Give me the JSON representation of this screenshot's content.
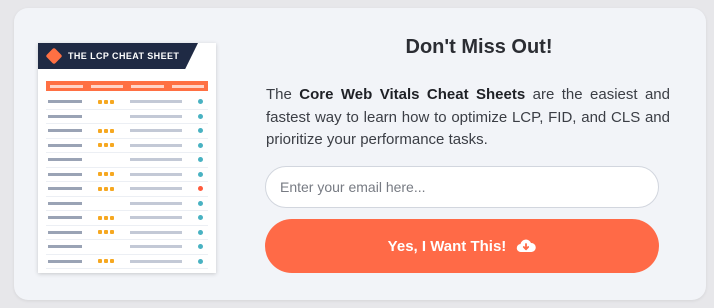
{
  "cheat_sheet": {
    "title": "THE LCP CHEAT SHEET",
    "icon": "flag-icon"
  },
  "heading": "Don't Miss Out!",
  "description": {
    "prefix": "The ",
    "highlight": "Core Web Vitals Cheat Sheets",
    "suffix": " are the easiest and fastest way to learn how to optimize LCP, FID, and CLS and prioritize your performance tasks."
  },
  "form": {
    "email_placeholder": "Enter your email here...",
    "submit_label": "Yes, I Want This!",
    "submit_icon": "cloud-download-icon"
  },
  "colors": {
    "accent": "#ff6a47",
    "sheet_header": "#1f2a44",
    "card_bg": "#f2f4f8"
  }
}
